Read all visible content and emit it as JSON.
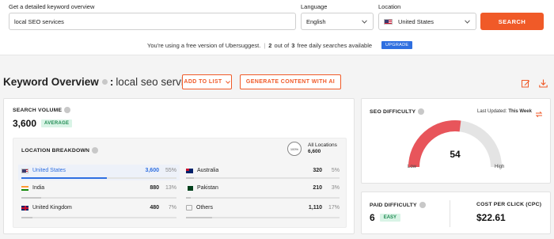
{
  "search": {
    "keyword_label": "Get a detailed keyword overview",
    "keyword_value": "local SEO services",
    "language_label": "Language",
    "language_value": "English",
    "location_label": "Location",
    "location_value": "United States",
    "search_button": "SEARCH"
  },
  "notice": {
    "text": "You're using a free version of Ubersuggest.",
    "used": "2",
    "out_of": "out of",
    "total": "3",
    "remaining": "free daily searches available",
    "upgrade": "UPGRADE"
  },
  "header": {
    "title": "Keyword Overview",
    "separator": ":",
    "keyword": "local seo services",
    "add_to_list": "ADD TO LIST",
    "generate": "GENERATE CONTENT WITH AI"
  },
  "search_volume": {
    "label": "SEARCH VOLUME",
    "value": "3,600",
    "badge": "AVERAGE"
  },
  "location_breakdown": {
    "label": "LOCATION BREAKDOWN",
    "all_label": "All Locations",
    "all_value": "6,600",
    "all_pct": "100%",
    "left": [
      {
        "name": "United States",
        "count": "3,600",
        "pct": "55%",
        "share": 0.55
      },
      {
        "name": "India",
        "count": "880",
        "pct": "13%",
        "share": 0.13
      },
      {
        "name": "United Kingdom",
        "count": "480",
        "pct": "7%",
        "share": 0.07
      }
    ],
    "right": [
      {
        "name": "Australia",
        "count": "320",
        "pct": "5%",
        "share": 0.05
      },
      {
        "name": "Pakistan",
        "count": "210",
        "pct": "3%",
        "share": 0.03
      },
      {
        "name": "Others",
        "count": "1,110",
        "pct": "17%",
        "share": 0.17
      }
    ]
  },
  "seo_difficulty": {
    "label": "SEO DIFFICULTY",
    "updated_prefix": "Last Updated:",
    "updated_value": "This Week",
    "value": "54",
    "low": "Low",
    "high": "High",
    "score": 54,
    "color": "#e8555b"
  },
  "paid_difficulty": {
    "label": "PAID DIFFICULTY",
    "value": "6",
    "badge": "EASY"
  },
  "cpc": {
    "label": "COST PER CLICK (CPC)",
    "value": "$22.61"
  },
  "colors": {
    "accent": "#f05a28",
    "link": "#2f6fe0"
  }
}
